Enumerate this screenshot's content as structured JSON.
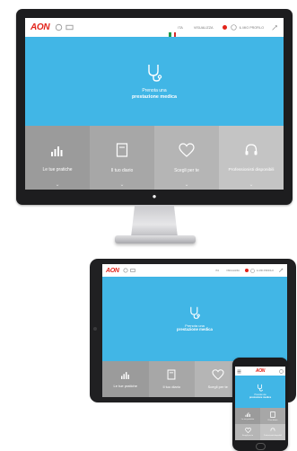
{
  "header": {
    "logo": "AON",
    "language": "ITA",
    "center_label": "VISUALIZZA",
    "user_label": "IL MIO PROFILO"
  },
  "hero": {
    "subtitle": "Prenota una",
    "title": "prestazione medica",
    "icon": "stethoscope-icon"
  },
  "tiles": [
    {
      "label": "Le tue pratiche",
      "icon": "bar-chart-icon",
      "color": "#9b9b9b"
    },
    {
      "label": "Il tuo diario",
      "icon": "diary-icon",
      "color": "#a7a7a7"
    },
    {
      "label": "Scegli per te",
      "icon": "heart-icon",
      "color": "#b5b5b5"
    },
    {
      "label": "Professionisti disponibili",
      "icon": "headset-icon",
      "color": "#c4c4c4"
    }
  ],
  "colors": {
    "brand_red": "#e2231a",
    "hero_blue": "#41b6e6",
    "device_dark": "#1d1d1f"
  }
}
